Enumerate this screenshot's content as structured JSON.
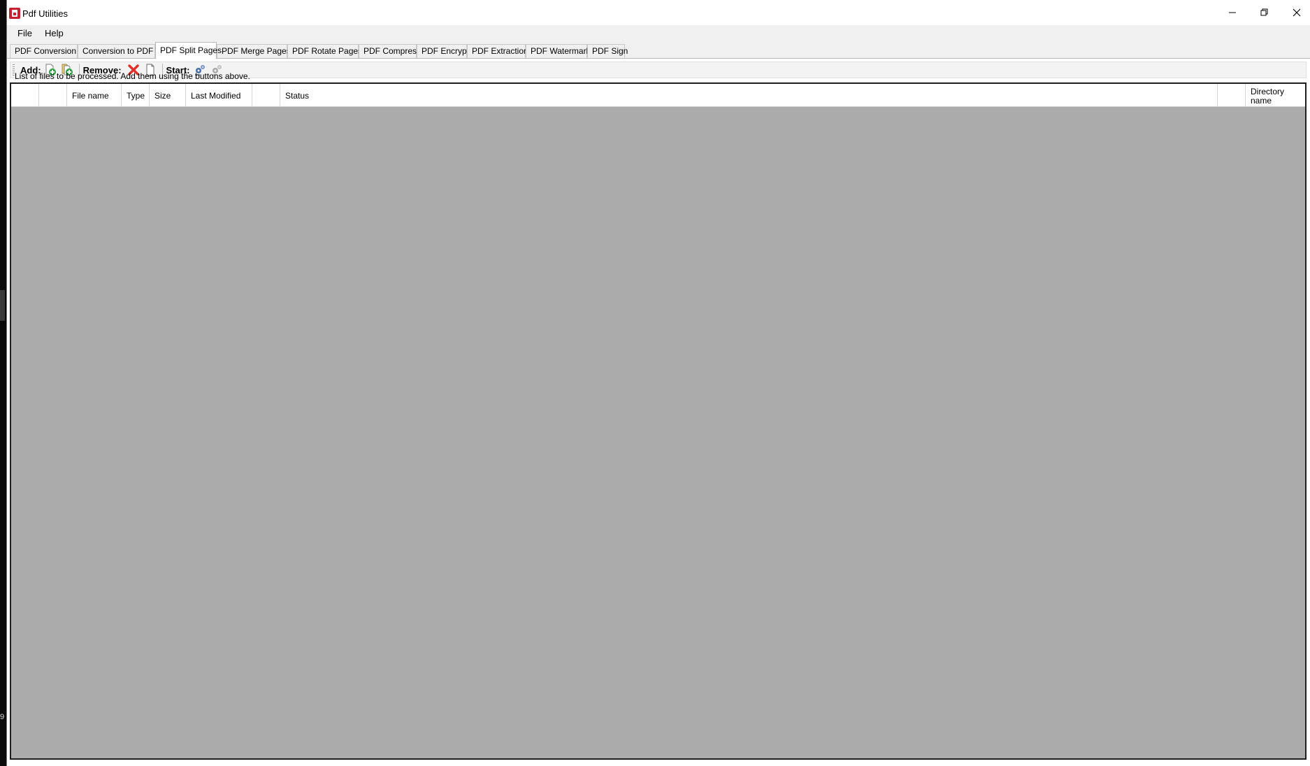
{
  "window": {
    "title": "Pdf Utilities"
  },
  "desktop": {
    "edge_digit": "9"
  },
  "menu": {
    "items": [
      "File",
      "Help"
    ]
  },
  "tabs": {
    "items": [
      {
        "label": "PDF Conversion to"
      },
      {
        "label": "Conversion to PDF"
      },
      {
        "label": "PDF Split Pages"
      },
      {
        "label": "PDF Merge Pages"
      },
      {
        "label": "PDF Rotate Pages"
      },
      {
        "label": "PDF Compress"
      },
      {
        "label": "PDF Encrypt"
      },
      {
        "label": "PDF Extraction"
      },
      {
        "label": "PDF Watermark"
      },
      {
        "label": "PDF Sign"
      }
    ],
    "selected": "PDF Split Pages"
  },
  "toolbar": {
    "add_label": "Add:",
    "remove_label": "Remove:",
    "start_label": "Start:",
    "icons": {
      "add_file": "add-file-icon",
      "add_folder": "add-folder-icon",
      "remove_selected": "remove-x-icon",
      "remove_all": "blank-page-icon",
      "start": "gears-start-icon",
      "stop": "gears-disabled-icon"
    },
    "colors": {
      "add_green": "#2ea043",
      "remove_red": "#e0302c",
      "start_blue": "#4a6fa8"
    }
  },
  "file_list": {
    "caption": "List of files to be processed. Add  them using the buttons above.",
    "columns": {
      "check": "",
      "icon": "",
      "file_name": "File name",
      "type": "Type",
      "size": "Size",
      "last_modified": "Last Modified",
      "blank": "",
      "status": "Status",
      "spacer": "",
      "directory_name": "Directory name"
    },
    "rows": [],
    "empty_background": "#ababab"
  }
}
